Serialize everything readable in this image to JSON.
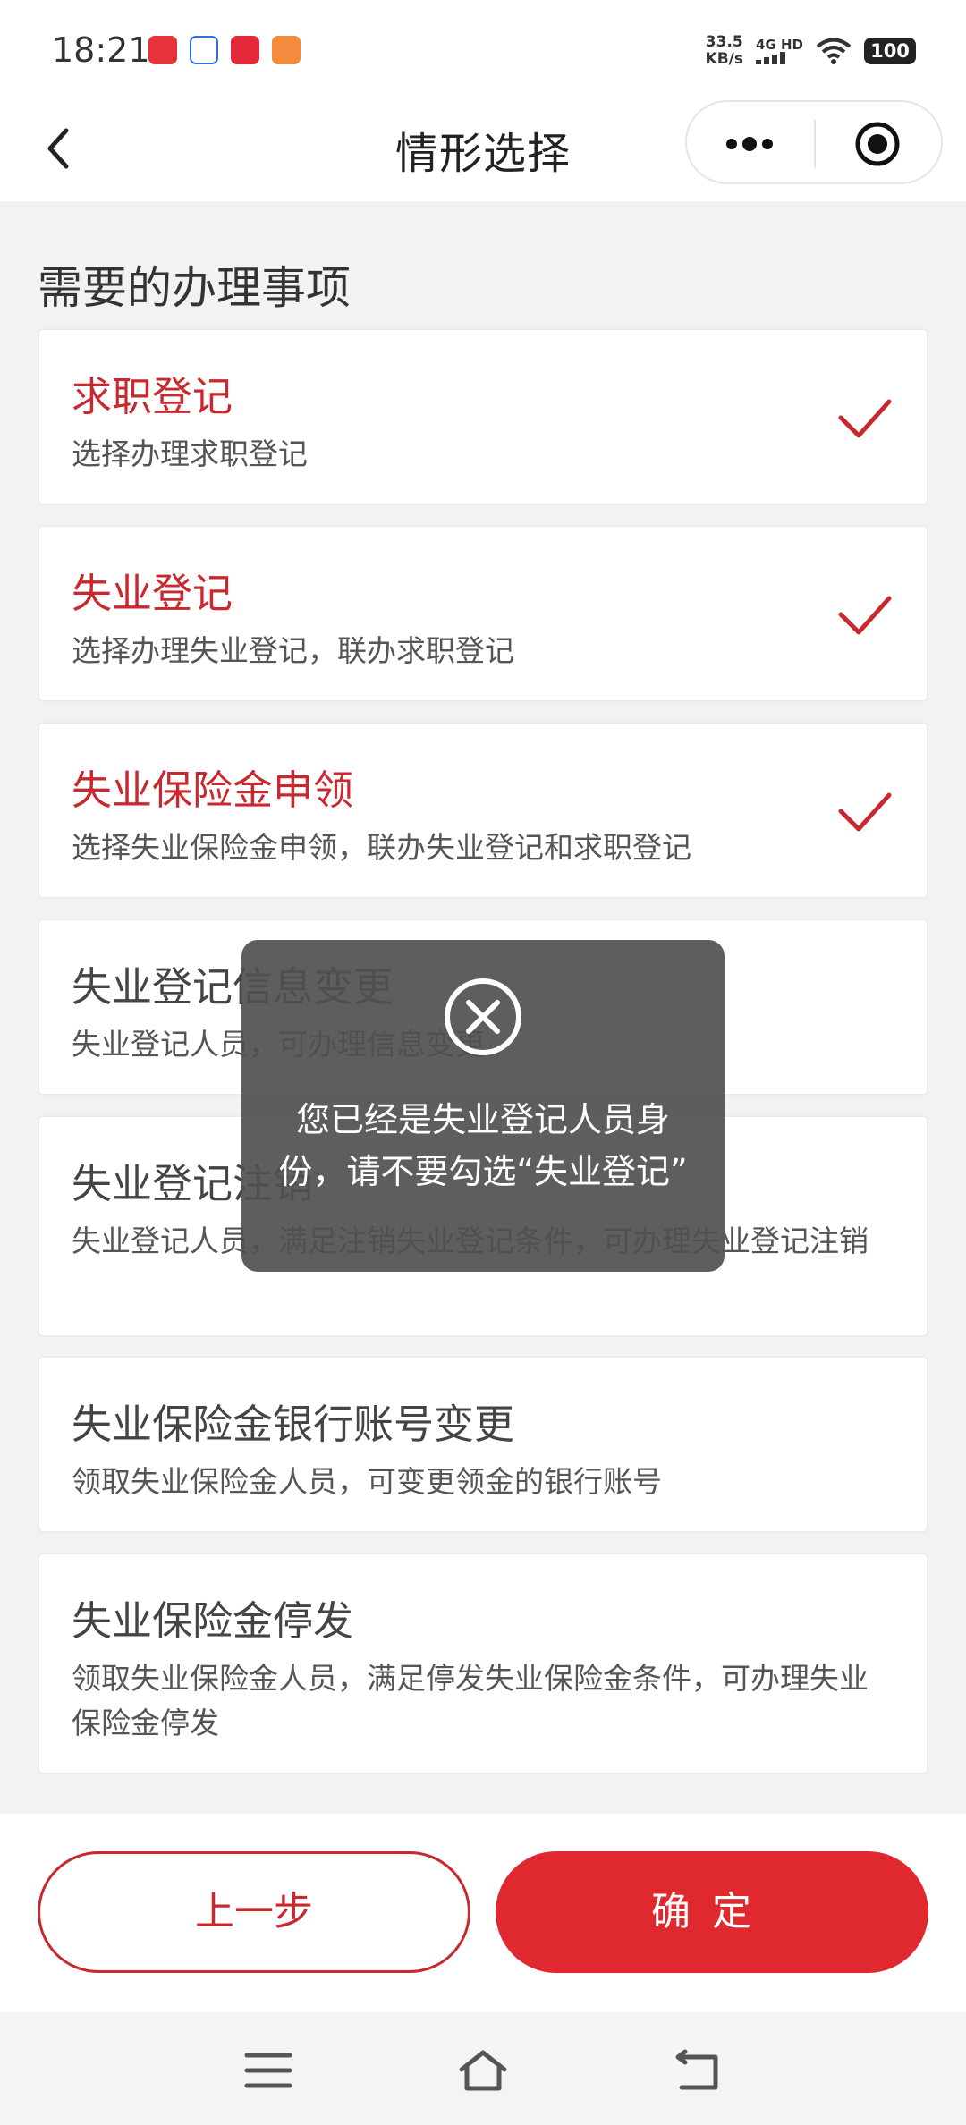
{
  "status_bar": {
    "time": "18:21",
    "net_speed_value": "33.5",
    "net_speed_unit": "KB/s",
    "net_type": "4G HD",
    "battery": "100",
    "app_icons": [
      "taobao-icon",
      "baidu-icon",
      "xiaohongshu-icon",
      "orange-app-icon"
    ]
  },
  "nav": {
    "title": "情形选择"
  },
  "section_title": "需要的办理事项",
  "items": [
    {
      "title": "求职登记",
      "desc": "选择办理求职登记",
      "selected": true
    },
    {
      "title": "失业登记",
      "desc": "选择办理失业登记，联办求职登记",
      "selected": true
    },
    {
      "title": "失业保险金申领",
      "desc": "选择失业保险金申领，联办失业登记和求职登记",
      "selected": true
    },
    {
      "title": "失业登记信息变更",
      "desc": "失业登记人员，可办理信息变更",
      "selected": false
    },
    {
      "title": "失业登记注销",
      "desc": "失业登记人员，满足注销失业登记条件，可办理失业登记注销",
      "selected": false
    },
    {
      "title": "失业保险金银行账号变更",
      "desc": "领取失业保险金人员，可变更领金的银行账号",
      "selected": false
    },
    {
      "title": "失业保险金停发",
      "desc": "领取失业保险金人员，满足停发失业保险金条件，可办理失业保险金停发",
      "selected": false
    }
  ],
  "toast": {
    "message": "您已经是失业登记人员身份，请不要勾选“失业登记”"
  },
  "buttons": {
    "prev": "上一步",
    "confirm": "确定"
  },
  "colors": {
    "accent": "#c9292e",
    "confirm_bg": "#e0292e"
  }
}
